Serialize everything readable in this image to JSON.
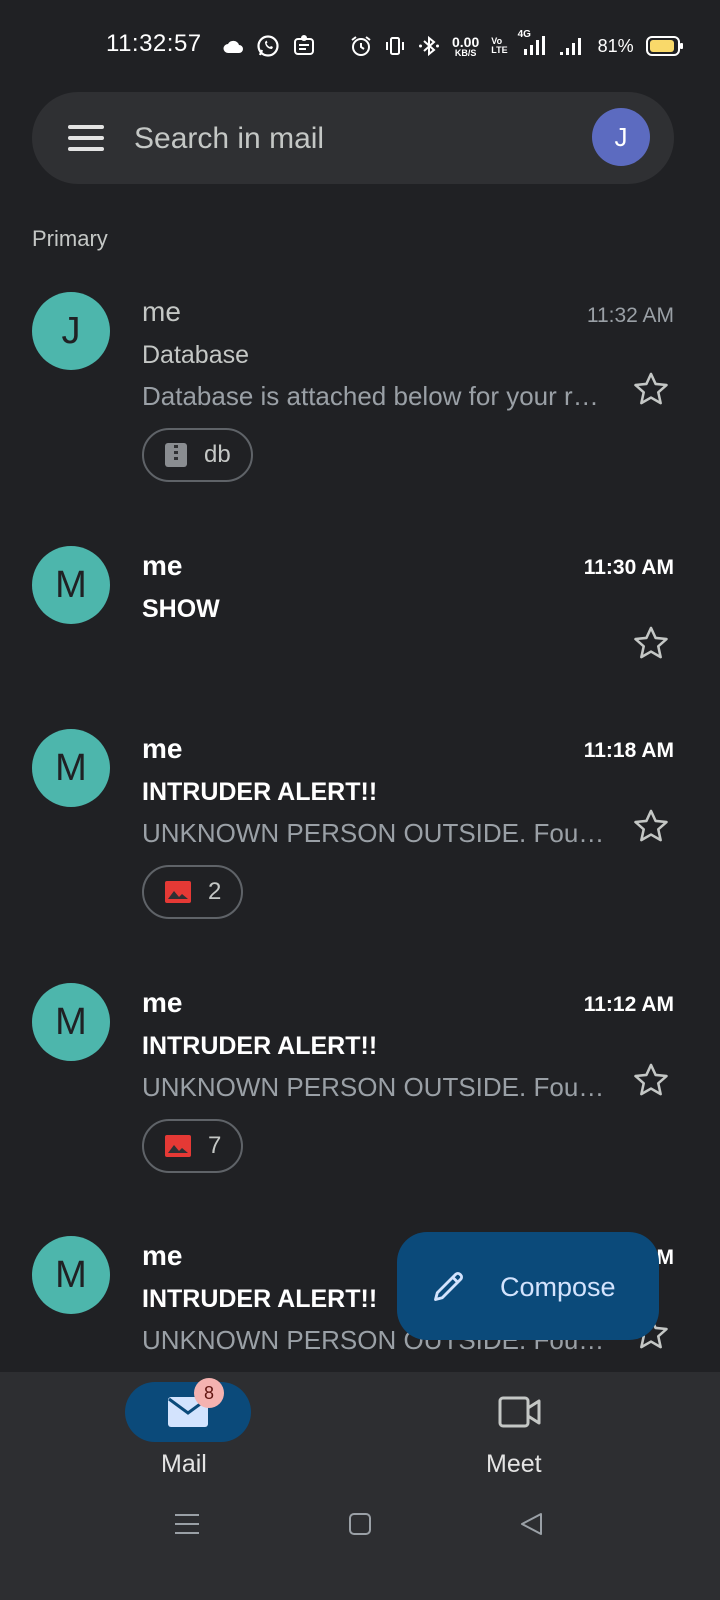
{
  "status_bar": {
    "time": "11:32:57",
    "net_speed_value": "0.00",
    "net_speed_unit": "KB/S",
    "volte_top": "Vo",
    "volte_bottom": "LTE",
    "network_type": "4G",
    "battery_percent": "81%",
    "icons": [
      "cloud-icon",
      "whatsapp-icon",
      "notification-icon",
      "alarm-icon",
      "vibrate-icon",
      "bluetooth-icon",
      "signal-icon",
      "signal-icon",
      "battery-icon"
    ]
  },
  "search": {
    "placeholder": "Search in mail",
    "account_initial": "J"
  },
  "section_label": "Primary",
  "emails": [
    {
      "avatar": "J",
      "sender": "me",
      "time": "11:32 AM",
      "subject": "Database",
      "snippet": "Database is attached below for your review",
      "unread": false,
      "attachment": {
        "icon": "zip-file-icon",
        "label": "db"
      }
    },
    {
      "avatar": "M",
      "sender": "me",
      "time": "11:30 AM",
      "subject": "SHOW",
      "snippet": "",
      "unread": true
    },
    {
      "avatar": "M",
      "sender": "me",
      "time": "11:18 AM",
      "subject": "INTRUDER ALERT!!",
      "snippet": "UNKNOWN PERSON OUTSIDE. Found at the door",
      "unread": true,
      "attachment": {
        "icon": "image-icon",
        "label": "2"
      }
    },
    {
      "avatar": "M",
      "sender": "me",
      "time": "11:12 AM",
      "subject": "INTRUDER ALERT!!",
      "snippet": "UNKNOWN PERSON OUTSIDE. Found at the door",
      "unread": true,
      "attachment": {
        "icon": "image-icon",
        "label": "7"
      }
    },
    {
      "avatar": "M",
      "sender": "me",
      "time": "11:05 AM",
      "subject": "INTRUDER ALERT!!",
      "snippet": "UNKNOWN PERSON OUTSIDE. Found at the door",
      "unread": true
    }
  ],
  "compose": {
    "label": "Compose"
  },
  "bottom_nav": {
    "mail": {
      "label": "Mail",
      "badge": "8"
    },
    "meet": {
      "label": "Meet"
    }
  },
  "colors": {
    "background": "#202124",
    "avatar_teal": "#4db6ac",
    "account_avatar": "#5c6bc0",
    "compose_bg": "#0b4a7a",
    "badge": "#f4b2b0",
    "image_icon": "#e53935"
  }
}
